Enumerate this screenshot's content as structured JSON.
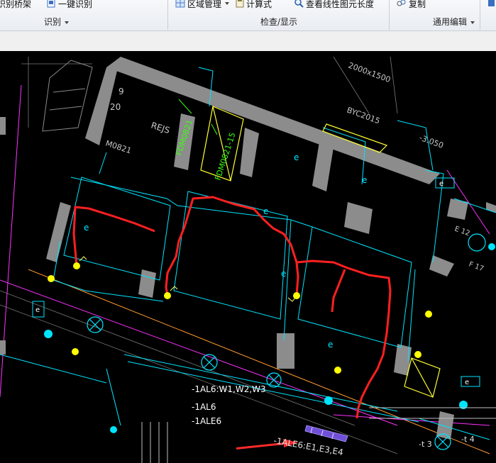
{
  "ribbon": {
    "buttons": [
      {
        "label": "识别桥架"
      },
      {
        "label": "一键识别"
      },
      {
        "label": "区域管理"
      },
      {
        "label": "计算式"
      },
      {
        "label": "查看线性图元长度"
      },
      {
        "label": "复制"
      }
    ],
    "groups": [
      {
        "label": "识别"
      },
      {
        "label": "检查/显示"
      },
      {
        "label": "通用编辑"
      }
    ]
  },
  "drawing": {
    "labels": {
      "dim_top": "2000x1500",
      "byc": "BYC2015",
      "elev": "-3.050",
      "num9": "9",
      "num20": "20",
      "rejs": "REJS",
      "m0821": "M0821",
      "fdm_a": "FDM0821",
      "fdm_b": "FDM0821-15",
      "e": "e",
      "e12": "E 12",
      "f17": "F 17",
      "wl1": "-1AL6:W1,W2,W3",
      "wl2": "-1AL6",
      "wl3": "-1ALE6",
      "wl4": "-1ALE6:E1,E3,E4",
      "t3": "-t 3",
      "t4": "-t 4"
    },
    "colors": {
      "wall_fill": "#8c8c8c",
      "wall_line": "#00e5ff",
      "red_route": "#ff2020",
      "arrow": "#ff2a2a",
      "lamp": "#ffff00",
      "green_text": "#39ff14",
      "magenta": "#ff30ff",
      "orange": "#ff9a30"
    }
  }
}
